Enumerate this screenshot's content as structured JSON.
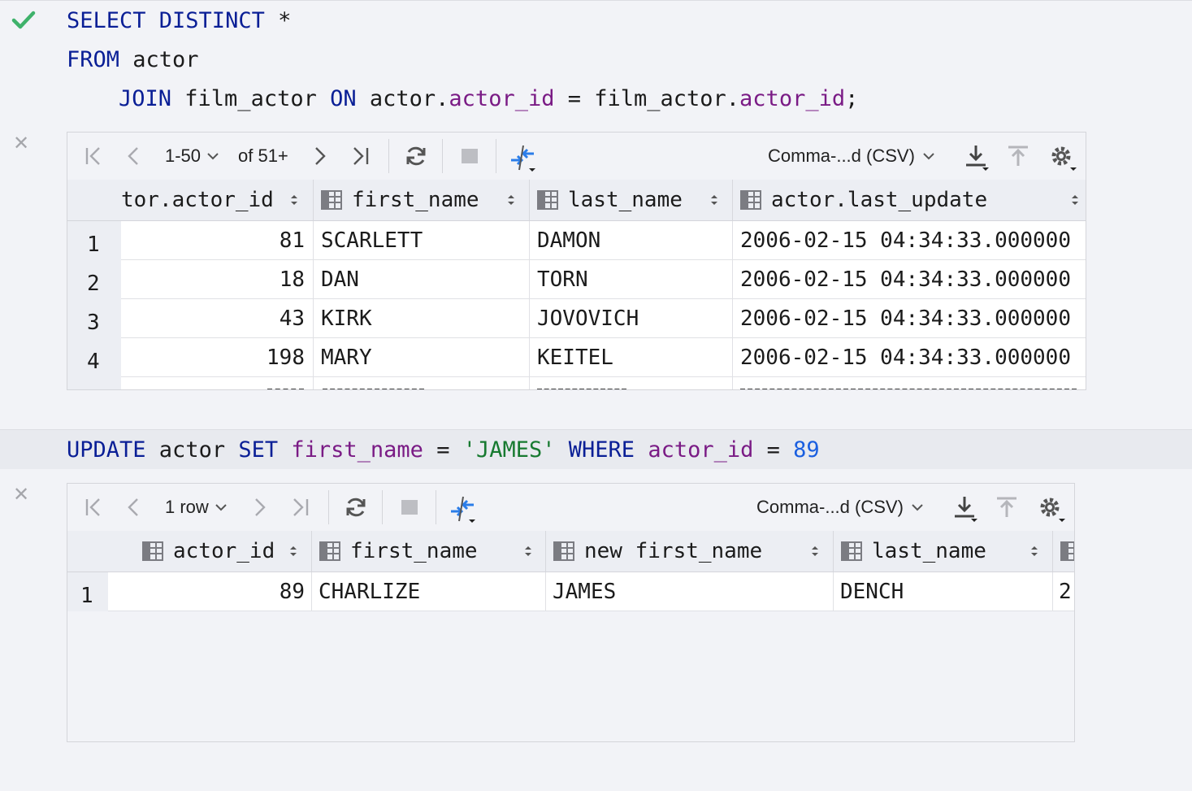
{
  "query1": {
    "line1_kw": "SELECT DISTINCT",
    "line1_rest": " *",
    "line2_kw": "FROM",
    "line2_rest": " actor",
    "line3_kw1": "JOIN",
    "line3_t1": " film_actor ",
    "line3_kw2": "ON",
    "line3_t2": " actor.",
    "line3_f1": "actor_id",
    "line3_t3": " = film_actor.",
    "line3_f2": "actor_id",
    "line3_t4": ";"
  },
  "result1": {
    "pager": "1-50",
    "total": "of 51+",
    "export_format": "Comma-...d (CSV)",
    "columns": [
      "tor.actor_id",
      "first_name",
      "last_name",
      "actor.last_update"
    ],
    "rows": [
      {
        "num": "1",
        "actor_id": "81",
        "first_name": "SCARLETT",
        "last_name": "DAMON",
        "last_update": "2006-02-15 04:34:33.000000"
      },
      {
        "num": "2",
        "actor_id": "18",
        "first_name": "DAN",
        "last_name": "TORN",
        "last_update": "2006-02-15 04:34:33.000000"
      },
      {
        "num": "3",
        "actor_id": "43",
        "first_name": "KIRK",
        "last_name": "JOVOVICH",
        "last_update": "2006-02-15 04:34:33.000000"
      },
      {
        "num": "4",
        "actor_id": "198",
        "first_name": "MARY",
        "last_name": "KEITEL",
        "last_update": "2006-02-15 04:34:33.000000"
      }
    ]
  },
  "query2": {
    "kw1": "UPDATE",
    "t1": " actor ",
    "kw2": "SET",
    "f1": " first_name",
    "t2": " = ",
    "s1": "'JAMES'",
    "kw3": " WHERE",
    "f2": " actor_id",
    "t3": " = ",
    "n1": "89"
  },
  "result2": {
    "pager": "1 row",
    "export_format": "Comma-...d (CSV)",
    "columns": [
      "actor_id",
      "first_name",
      "new first_name",
      "last_name"
    ],
    "rows": [
      {
        "num": "1",
        "actor_id": "89",
        "first_name": "CHARLIZE",
        "new_first_name": "JAMES",
        "last_name": "DENCH",
        "cut": "2"
      }
    ]
  },
  "colors": {
    "keyword": "#0a1f96",
    "field": "#7a1b85",
    "string": "#177a30",
    "number": "#1a5fe0",
    "success": "#3fb26b",
    "accent": "#2b7de9"
  },
  "icons": [
    "check-icon",
    "close-icon",
    "first-page-icon",
    "prev-page-icon",
    "next-page-icon",
    "last-page-icon",
    "reload-icon",
    "stop-icon",
    "compare-icon",
    "download-icon",
    "upload-icon",
    "settings-icon",
    "table-column-icon",
    "sort-icon"
  ]
}
